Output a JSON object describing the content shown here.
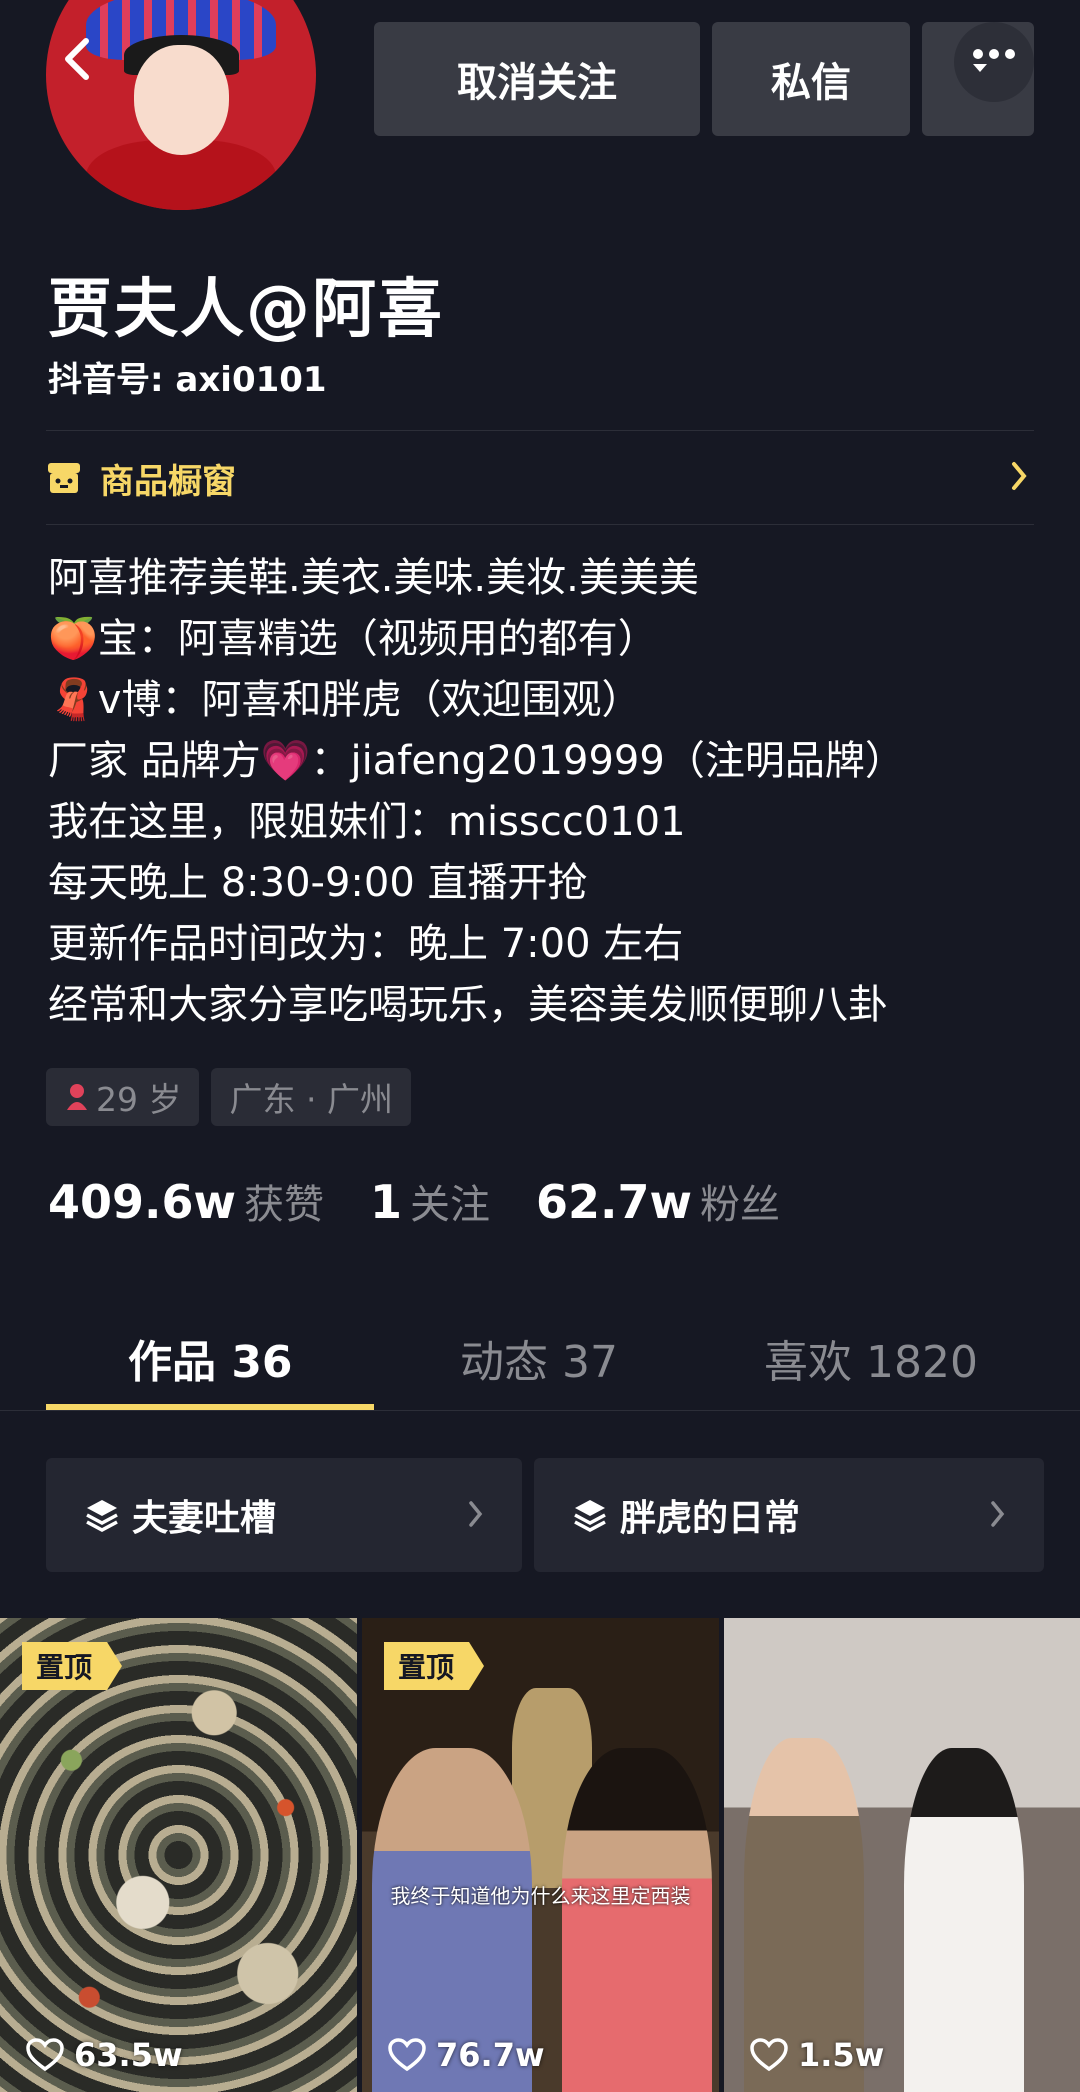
{
  "header": {
    "unfollow_label": "取消关注",
    "message_label": "私信"
  },
  "profile": {
    "name": "贾夫人@阿喜",
    "douyin_id": "抖音号: axi0101",
    "shop_label": "商品橱窗",
    "bio_lines": [
      "阿喜推荐美鞋.美衣.美味.美妆.美美美",
      "🍑宝：阿喜精选（视频用的都有）",
      "🧣v博：阿喜和胖虎（欢迎围观）",
      "厂家 品牌方💗：jiafeng2019999（注明品牌）",
      "我在这里，限姐妹们：misscc0101",
      "每天晚上 8:30-9:00 直播开抢",
      "更新作品时间改为：晚上 7:00 左右",
      "经常和大家分享吃喝玩乐，美容美发顺便聊八卦"
    ],
    "age_tag": "29 岁",
    "location_tag": "广东 · 广州"
  },
  "stats": {
    "likes_num": "409.6w",
    "likes_label": "获赞",
    "following_num": "1",
    "following_label": "关注",
    "fans_num": "62.7w",
    "fans_label": "粉丝"
  },
  "tabs": {
    "works": "作品 36",
    "dynamics": "动态 37",
    "liked": "喜欢 1820"
  },
  "collections": [
    {
      "label": "夫妻吐槽"
    },
    {
      "label": "胖虎的日常"
    }
  ],
  "videos": [
    {
      "pinned_label": "置顶",
      "likes": "63.5w"
    },
    {
      "pinned_label": "置顶",
      "likes": "76.7w",
      "caption": "我终于知道他为什么来这里定西装"
    },
    {
      "likes": "1.5w"
    }
  ],
  "colors": {
    "background": "#161823",
    "accent": "#f7d767",
    "button": "#393b44",
    "muted_text": "#8a8b91"
  },
  "icons": [
    "back-icon",
    "more-icon",
    "shop-icon",
    "chevron-right-icon",
    "female-icon",
    "collection-icon",
    "heart-icon"
  ]
}
